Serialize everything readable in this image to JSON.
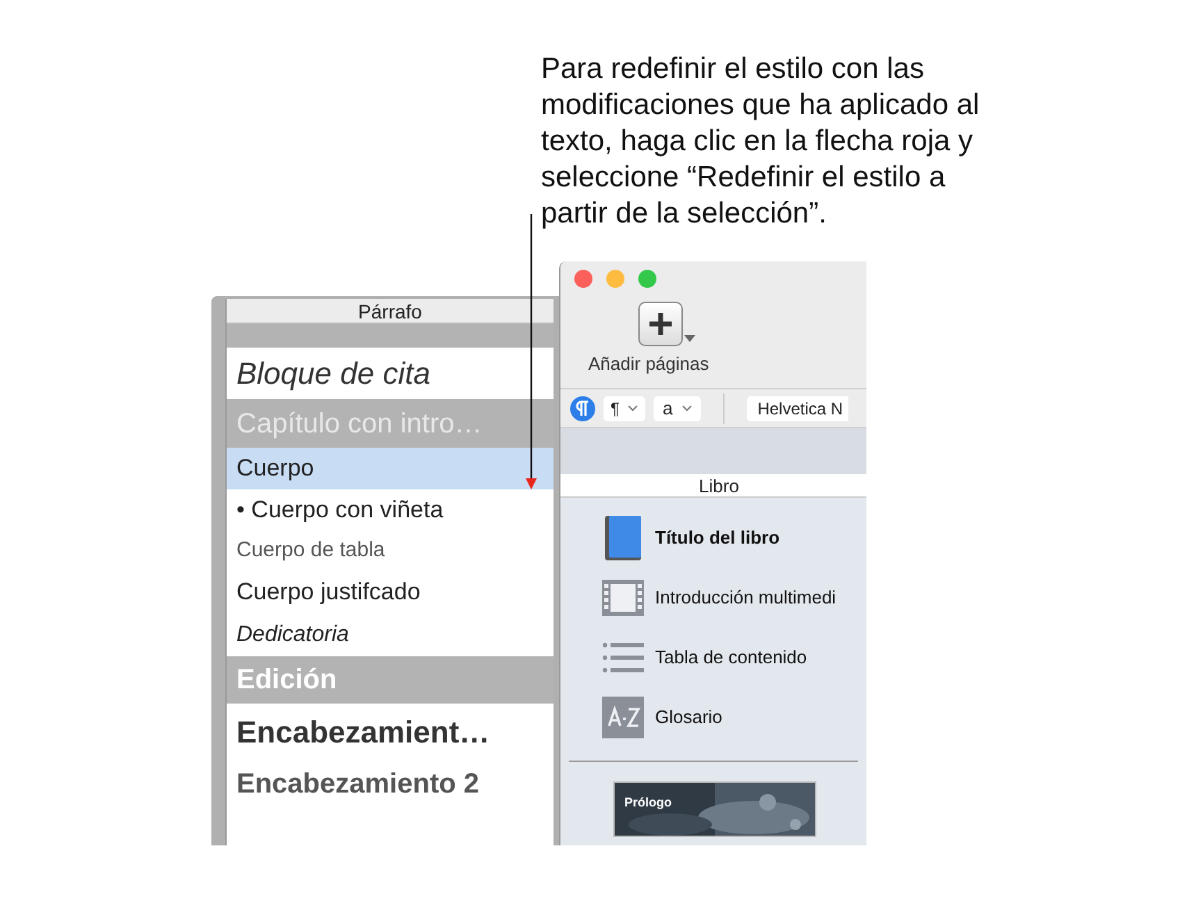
{
  "callout": {
    "text": "Para redefinir el estilo con las modificaciones que ha aplicado al texto, haga clic en la flecha roja y seleccione “Redefinir el estilo a partir de la selección”."
  },
  "paragraph_panel": {
    "title": "Párrafo",
    "styles": [
      {
        "label": "Bloque de cita",
        "kind": "quote",
        "selected": false
      },
      {
        "label": "Capítulo con intro…",
        "kind": "banner-light",
        "selected": false
      },
      {
        "label": "Cuerpo",
        "kind": "body",
        "selected": true
      },
      {
        "label": "• Cuerpo con viñeta",
        "kind": "body",
        "selected": false
      },
      {
        "label": "Cuerpo de tabla",
        "kind": "small",
        "selected": false
      },
      {
        "label": "Cuerpo justifcado",
        "kind": "body",
        "selected": false
      },
      {
        "label": "Dedicatoria",
        "kind": "italic",
        "selected": false
      },
      {
        "label": "Edición",
        "kind": "banner",
        "selected": false
      },
      {
        "label": "Encabezamient…",
        "kind": "title",
        "selected": false
      },
      {
        "label": "Encabezamiento 2",
        "kind": "subtitle",
        "selected": false
      }
    ]
  },
  "window": {
    "toolbar": {
      "add_pages": "Añadir páginas"
    },
    "format_bar": {
      "paragraph_popup": "¶",
      "character_popup": "a",
      "font_field": "Helvetica N"
    },
    "sidebar": {
      "title": "Libro",
      "items": [
        {
          "label": "Título del libro",
          "kind": "book",
          "selected": true
        },
        {
          "label": "Introducción multimedi",
          "kind": "film",
          "selected": false
        },
        {
          "label": "Tabla de contenido",
          "kind": "list",
          "selected": false
        },
        {
          "label": "Glosario",
          "kind": "glossary",
          "selected": false
        }
      ],
      "thumbnail": {
        "label": "Prólogo",
        "kind": "picture"
      }
    }
  }
}
